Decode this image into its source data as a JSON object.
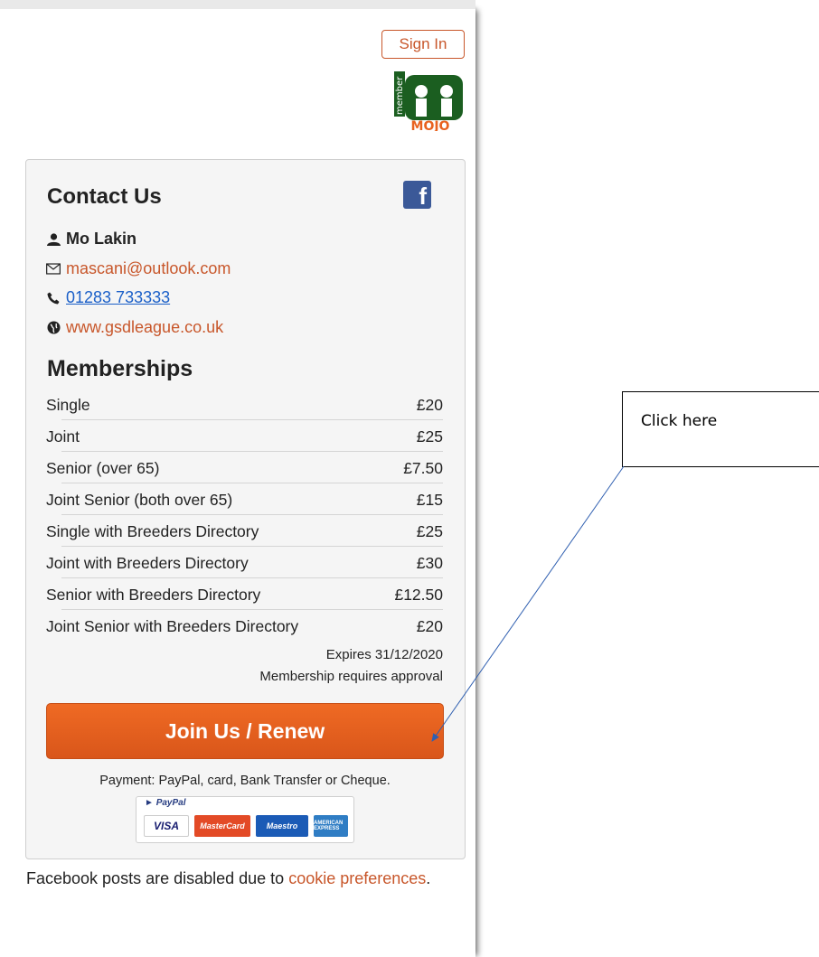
{
  "header": {
    "sign_in": "Sign In"
  },
  "logo": {
    "top_text": "member",
    "bottom_text": "MOJO"
  },
  "contact": {
    "heading": "Contact Us",
    "name": "Mo Lakin",
    "email": "mascani@outlook.com",
    "phone": "01283 733333",
    "website": "www.gsdleague.co.uk"
  },
  "memberships": {
    "heading": "Memberships",
    "items": [
      {
        "label": "Single",
        "price": "£20"
      },
      {
        "label": "Joint",
        "price": "£25"
      },
      {
        "label": "Senior (over 65)",
        "price": "£7.50"
      },
      {
        "label": "Joint Senior (both over 65)",
        "price": "£15"
      },
      {
        "label": "Single with Breeders Directory",
        "price": "£25"
      },
      {
        "label": "Joint with Breeders Directory",
        "price": "£30"
      },
      {
        "label": "Senior with Breeders Directory",
        "price": "£12.50"
      },
      {
        "label": "Joint Senior with Breeders Directory",
        "price": "£20"
      }
    ],
    "expires": "Expires 31/12/2020",
    "approval": "Membership requires approval"
  },
  "join_button": "Join Us / Renew",
  "payment": {
    "text": "Payment: PayPal, card, Bank Transfer or Cheque.",
    "paypal_label": "PayPal",
    "cards": [
      "VISA",
      "MasterCard",
      "Maestro",
      "AMERICAN EXPRESS"
    ]
  },
  "facebook_notice": {
    "text": "Facebook posts are disabled due to ",
    "link": "cookie preferences",
    "end": "."
  },
  "annotation": {
    "callout": "Click here"
  },
  "colors": {
    "accent": "#c8572b",
    "button": "#e8621f",
    "facebook": "#3b5998",
    "link": "#1a5fc8",
    "logo_green": "#1b5e20"
  }
}
